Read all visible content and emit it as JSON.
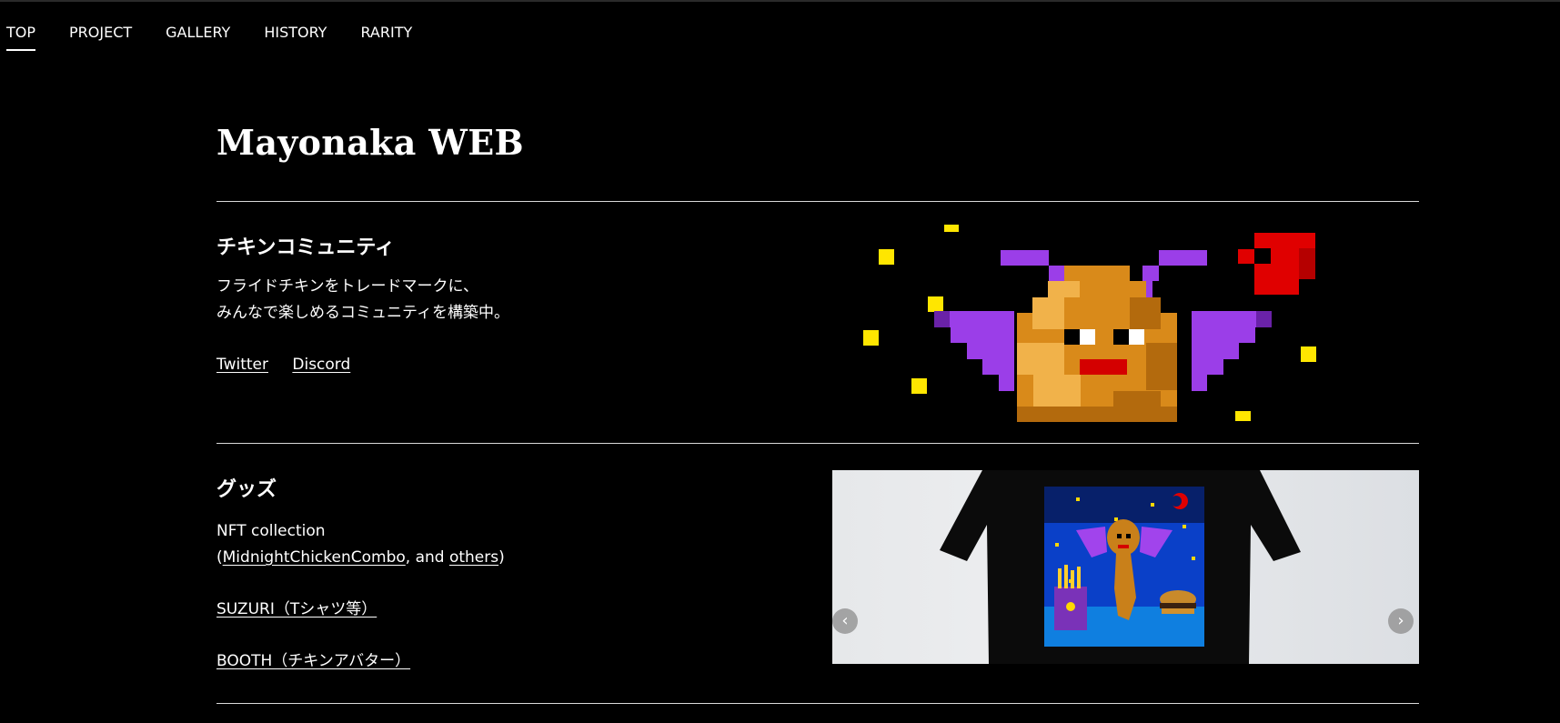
{
  "nav": {
    "items": [
      "TOP",
      "PROJECT",
      "GALLERY",
      "HISTORY",
      "RARITY"
    ],
    "active": "TOP"
  },
  "site": {
    "title": "Mayonaka WEB"
  },
  "community": {
    "title": "チキンコミュニティ",
    "line1": "フライドチキンをトレードマークに、",
    "line2": "みんなで楽しめるコミュニティを構築中。",
    "links": {
      "twitter": "Twitter",
      "discord": "Discord"
    },
    "image_icon": "fried-chicken-bat-pixel-art"
  },
  "goods": {
    "title": "グッズ",
    "line1": "NFT collection",
    "line2_prefix": "(",
    "line2_link1": "MidnightChickenCombo",
    "line2_middle": ", and ",
    "line2_link2": "others",
    "line2_suffix": ")",
    "suzuri": "SUZURI（Tシャツ等）",
    "booth": "BOOTH（チキンアバター）",
    "carousel": {
      "prev_icon": "chevron-left-icon",
      "next_icon": "chevron-right-icon",
      "prev_glyph": "‹",
      "next_glyph": "›"
    }
  },
  "colors": {
    "background": "#000000",
    "text": "#ffffff",
    "divider": "#d9d9d9"
  }
}
